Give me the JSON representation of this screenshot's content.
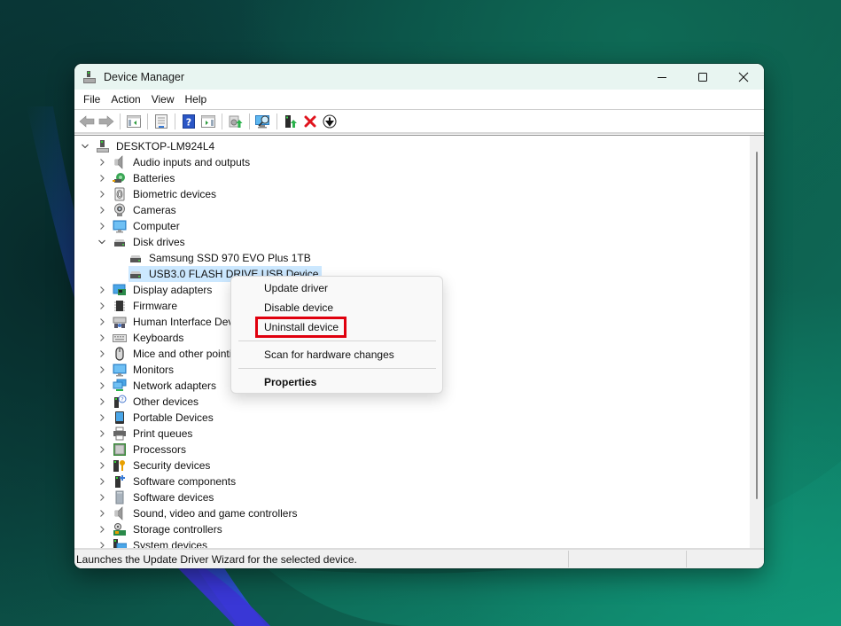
{
  "window": {
    "title": "Device Manager",
    "controls": {
      "minimize": "minimize",
      "maximize": "maximize",
      "close": "close"
    }
  },
  "menubar": {
    "items": [
      "File",
      "Action",
      "View",
      "Help"
    ]
  },
  "toolbar": {
    "buttons": [
      {
        "name": "back",
        "icon": "back-arrow-icon"
      },
      {
        "name": "forward",
        "icon": "forward-arrow-icon"
      },
      {
        "name": "show-hide-console-tree",
        "icon": "console-tree-icon"
      },
      {
        "name": "properties",
        "icon": "properties-sheet-icon"
      },
      {
        "name": "help",
        "icon": "help-icon"
      },
      {
        "name": "show-hide-action-pane",
        "icon": "action-pane-icon"
      },
      {
        "name": "update-driver",
        "icon": "update-driver-icon"
      },
      {
        "name": "scan-hardware",
        "icon": "scan-hardware-icon"
      },
      {
        "name": "enable-device",
        "icon": "enable-device-icon"
      },
      {
        "name": "uninstall-device",
        "icon": "uninstall-x-icon"
      },
      {
        "name": "disable-device",
        "icon": "disable-device-icon"
      }
    ]
  },
  "tree": {
    "root": {
      "label": "DESKTOP-LM924L4",
      "expanded": true
    },
    "categories": [
      {
        "label": "Audio inputs and outputs",
        "icon": "speaker-icon",
        "expanded": false
      },
      {
        "label": "Batteries",
        "icon": "battery-icon",
        "expanded": false
      },
      {
        "label": "Biometric devices",
        "icon": "fingerprint-icon",
        "expanded": false
      },
      {
        "label": "Cameras",
        "icon": "webcam-icon",
        "expanded": false
      },
      {
        "label": "Computer",
        "icon": "monitor-icon",
        "expanded": false
      },
      {
        "label": "Disk drives",
        "icon": "disk-drive-icon",
        "expanded": true,
        "children": [
          {
            "label": "Samsung SSD 970 EVO Plus 1TB",
            "icon": "disk-drive-icon",
            "selected": false
          },
          {
            "label": "USB3.0 FLASH DRIVE USB Device",
            "icon": "disk-drive-icon",
            "selected": true
          }
        ]
      },
      {
        "label": "Display adapters",
        "icon": "display-adapter-icon",
        "expanded": false
      },
      {
        "label": "Firmware",
        "icon": "chip-icon",
        "expanded": false
      },
      {
        "label": "Human Interface Devices",
        "icon": "hid-icon",
        "expanded": false
      },
      {
        "label": "Keyboards",
        "icon": "keyboard-icon",
        "expanded": false
      },
      {
        "label": "Mice and other pointing devices",
        "icon": "mouse-icon",
        "expanded": false
      },
      {
        "label": "Monitors",
        "icon": "monitor-icon",
        "expanded": false
      },
      {
        "label": "Network adapters",
        "icon": "network-icon",
        "expanded": false
      },
      {
        "label": "Other devices",
        "icon": "unknown-device-icon",
        "expanded": false
      },
      {
        "label": "Portable Devices",
        "icon": "portable-device-icon",
        "expanded": false
      },
      {
        "label": "Print queues",
        "icon": "printer-icon",
        "expanded": false
      },
      {
        "label": "Processors",
        "icon": "processor-icon",
        "expanded": false
      },
      {
        "label": "Security devices",
        "icon": "security-key-icon",
        "expanded": false
      },
      {
        "label": "Software components",
        "icon": "software-component-icon",
        "expanded": false
      },
      {
        "label": "Software devices",
        "icon": "software-device-icon",
        "expanded": false
      },
      {
        "label": "Sound, video and game controllers",
        "icon": "speaker-icon",
        "expanded": false
      },
      {
        "label": "Storage controllers",
        "icon": "storage-controller-icon",
        "expanded": false
      },
      {
        "label": "System devices",
        "icon": "system-device-icon",
        "expanded": false
      }
    ]
  },
  "context_menu": {
    "items": [
      {
        "label": "Update driver",
        "bold": false
      },
      {
        "label": "Disable device",
        "bold": false
      },
      {
        "label": "Uninstall device",
        "bold": false,
        "highlighted": true
      },
      {
        "separator": true
      },
      {
        "label": "Scan for hardware changes",
        "bold": false
      },
      {
        "separator": true
      },
      {
        "label": "Properties",
        "bold": true
      }
    ]
  },
  "statusbar": {
    "text": "Launches the Update Driver Wizard for the selected device."
  },
  "colors": {
    "titlebar": "#e8f5f1",
    "selection": "#cce8ff",
    "highlight_box": "#e0000e",
    "uninstall_x": "#e0141e"
  }
}
